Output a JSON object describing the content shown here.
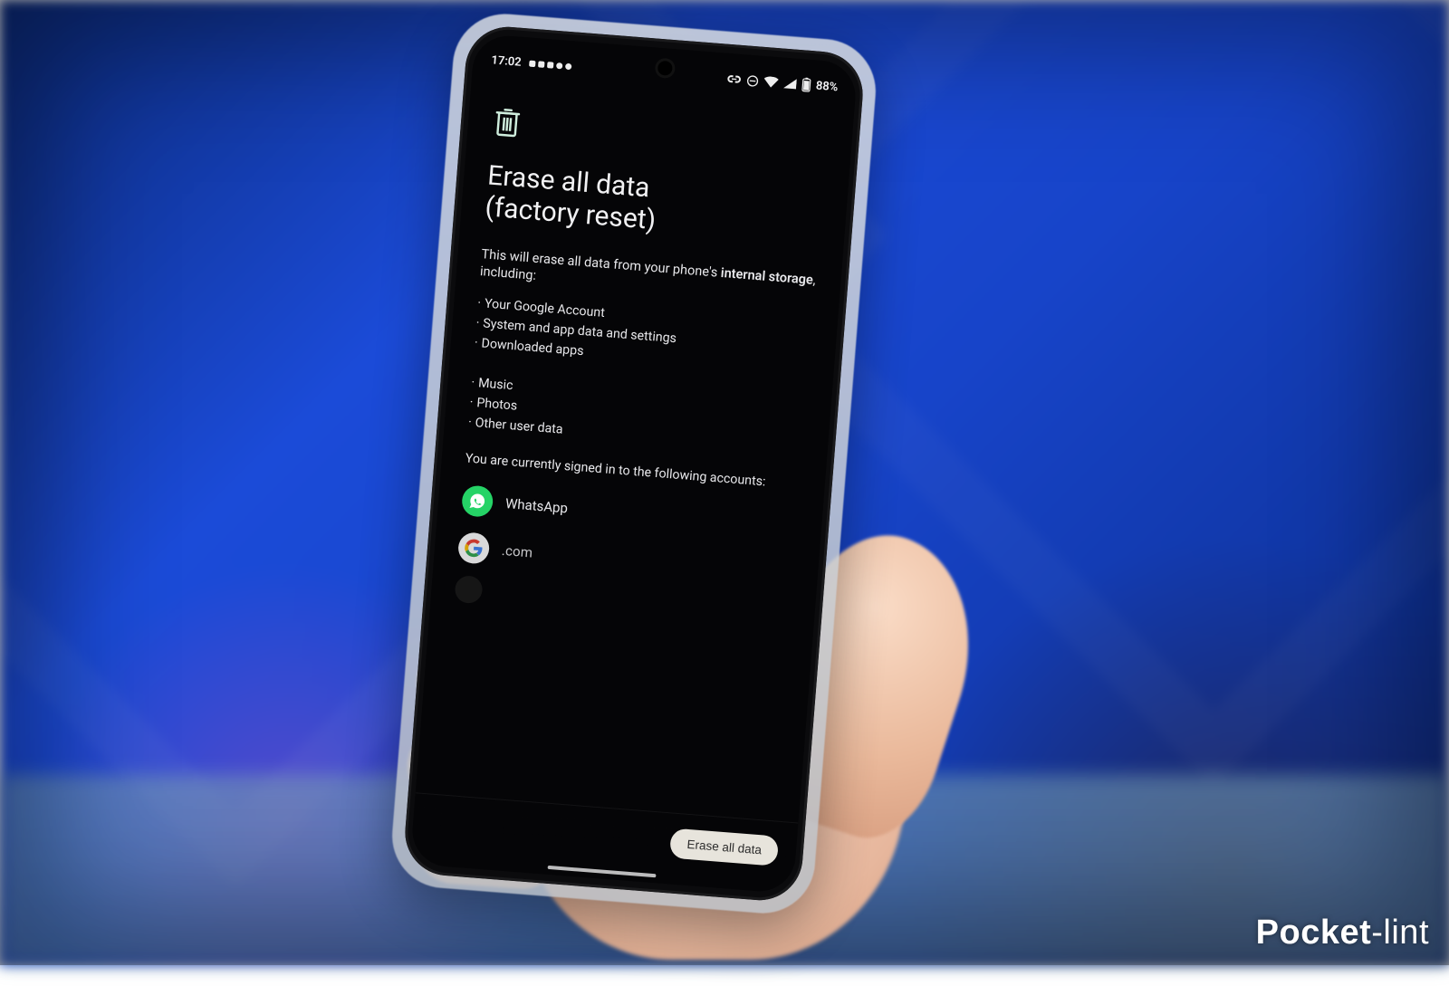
{
  "watermark": "Pocket-lint",
  "statusbar": {
    "time": "17:02",
    "battery_text": "88%"
  },
  "page": {
    "title_line1": "Erase all data",
    "title_line2": "(factory reset)",
    "description_pre": "This will erase all data from your phone's ",
    "description_bold": "internal storage",
    "description_post": ", including:",
    "items_group1": [
      "Your Google Account",
      "System and app data and settings",
      "Downloaded apps"
    ],
    "items_group2": [
      "Music",
      "Photos",
      "Other user data"
    ],
    "signed_in_text": "You are currently signed in to the following accounts:",
    "accounts": {
      "whatsapp": "WhatsApp",
      "google": ".com"
    },
    "erase_button": "Erase all data"
  }
}
